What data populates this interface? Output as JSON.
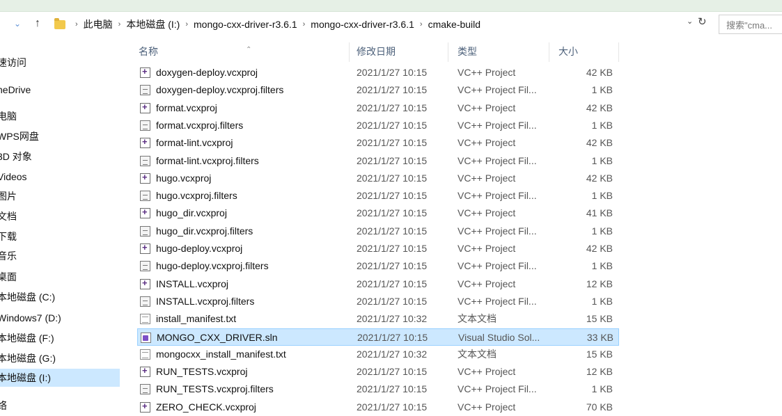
{
  "address": {
    "crumbs": [
      "此电脑",
      "本地磁盘 (I:)",
      "mongo-cxx-driver-r3.6.1",
      "mongo-cxx-driver-r3.6.1",
      "cmake-build"
    ],
    "search_placeholder": "搜索\"cma..."
  },
  "sidebar": {
    "items": [
      "速访问",
      "neDrive",
      "电脑",
      "WPS网盘",
      "3D 对象",
      "Videos",
      "图片",
      "文档",
      "下载",
      "音乐",
      "桌面",
      "本地磁盘 (C:)",
      "Windows7 (D:)",
      "本地磁盘 (F:)",
      "本地磁盘 (G:)",
      "本地磁盘 (I:)",
      "络"
    ],
    "selected_index": 15
  },
  "columns": {
    "name": "名称",
    "date": "修改日期",
    "type": "类型",
    "size": "大小"
  },
  "files": [
    {
      "name": "doxygen-deploy.vcxproj",
      "date": "2021/1/27 10:15",
      "type": "VC++ Project",
      "size": "42 KB",
      "icon": "vcxproj-file-icon"
    },
    {
      "name": "doxygen-deploy.vcxproj.filters",
      "date": "2021/1/27 10:15",
      "type": "VC++ Project Fil...",
      "size": "1 KB",
      "icon": "filters-file-icon"
    },
    {
      "name": "format.vcxproj",
      "date": "2021/1/27 10:15",
      "type": "VC++ Project",
      "size": "42 KB",
      "icon": "vcxproj-file-icon"
    },
    {
      "name": "format.vcxproj.filters",
      "date": "2021/1/27 10:15",
      "type": "VC++ Project Fil...",
      "size": "1 KB",
      "icon": "filters-file-icon"
    },
    {
      "name": "format-lint.vcxproj",
      "date": "2021/1/27 10:15",
      "type": "VC++ Project",
      "size": "42 KB",
      "icon": "vcxproj-file-icon"
    },
    {
      "name": "format-lint.vcxproj.filters",
      "date": "2021/1/27 10:15",
      "type": "VC++ Project Fil...",
      "size": "1 KB",
      "icon": "filters-file-icon"
    },
    {
      "name": "hugo.vcxproj",
      "date": "2021/1/27 10:15",
      "type": "VC++ Project",
      "size": "42 KB",
      "icon": "vcxproj-file-icon"
    },
    {
      "name": "hugo.vcxproj.filters",
      "date": "2021/1/27 10:15",
      "type": "VC++ Project Fil...",
      "size": "1 KB",
      "icon": "filters-file-icon"
    },
    {
      "name": "hugo_dir.vcxproj",
      "date": "2021/1/27 10:15",
      "type": "VC++ Project",
      "size": "41 KB",
      "icon": "vcxproj-file-icon"
    },
    {
      "name": "hugo_dir.vcxproj.filters",
      "date": "2021/1/27 10:15",
      "type": "VC++ Project Fil...",
      "size": "1 KB",
      "icon": "filters-file-icon"
    },
    {
      "name": "hugo-deploy.vcxproj",
      "date": "2021/1/27 10:15",
      "type": "VC++ Project",
      "size": "42 KB",
      "icon": "vcxproj-file-icon"
    },
    {
      "name": "hugo-deploy.vcxproj.filters",
      "date": "2021/1/27 10:15",
      "type": "VC++ Project Fil...",
      "size": "1 KB",
      "icon": "filters-file-icon"
    },
    {
      "name": "INSTALL.vcxproj",
      "date": "2021/1/27 10:15",
      "type": "VC++ Project",
      "size": "12 KB",
      "icon": "vcxproj-file-icon"
    },
    {
      "name": "INSTALL.vcxproj.filters",
      "date": "2021/1/27 10:15",
      "type": "VC++ Project Fil...",
      "size": "1 KB",
      "icon": "filters-file-icon"
    },
    {
      "name": "install_manifest.txt",
      "date": "2021/1/27 10:32",
      "type": "文本文档",
      "size": "15 KB",
      "icon": "text-file-icon"
    },
    {
      "name": "MONGO_CXX_DRIVER.sln",
      "date": "2021/1/27 10:15",
      "type": "Visual Studio Sol...",
      "size": "33 KB",
      "icon": "solution-file-icon"
    },
    {
      "name": "mongocxx_install_manifest.txt",
      "date": "2021/1/27 10:32",
      "type": "文本文档",
      "size": "15 KB",
      "icon": "text-file-icon"
    },
    {
      "name": "RUN_TESTS.vcxproj",
      "date": "2021/1/27 10:15",
      "type": "VC++ Project",
      "size": "12 KB",
      "icon": "vcxproj-file-icon"
    },
    {
      "name": "RUN_TESTS.vcxproj.filters",
      "date": "2021/1/27 10:15",
      "type": "VC++ Project Fil...",
      "size": "1 KB",
      "icon": "filters-file-icon"
    },
    {
      "name": "ZERO_CHECK.vcxproj",
      "date": "2021/1/27 10:15",
      "type": "VC++ Project",
      "size": "70 KB",
      "icon": "vcxproj-file-icon"
    }
  ],
  "selected_file_index": 15
}
